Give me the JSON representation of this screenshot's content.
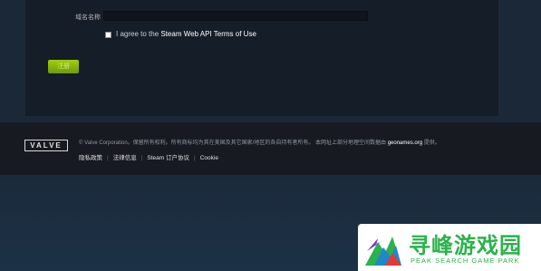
{
  "form": {
    "domain_label": "域名名称",
    "domain_value": "",
    "agree_prefix": "I agree to the ",
    "agree_link": "Steam Web API Terms of Use",
    "agree_checked": false,
    "register_label": "注册"
  },
  "footer": {
    "logo_text": "VALVE",
    "copyright_text": "© Valve Corporation。保留所有权利。所有商标均为其在美国及其它国家/地区的各自持有者所有。 本网址上部分地理空间数据由 ",
    "geonames_link": "geonames.org",
    "copyright_suffix": " 提供。",
    "links": [
      "隐私政策",
      "法律信息",
      "Steam 订户协议",
      "Cookie"
    ]
  },
  "watermark": {
    "title": "寻峰游戏园",
    "subtitle": "PEAK SEARCH GAME PARK"
  },
  "colors": {
    "page_bg": "#1b2838",
    "panel_bg": "#151d28",
    "footer_bg": "#171a21",
    "button_green": "#a4d007",
    "watermark_green": "#2bb24c"
  }
}
